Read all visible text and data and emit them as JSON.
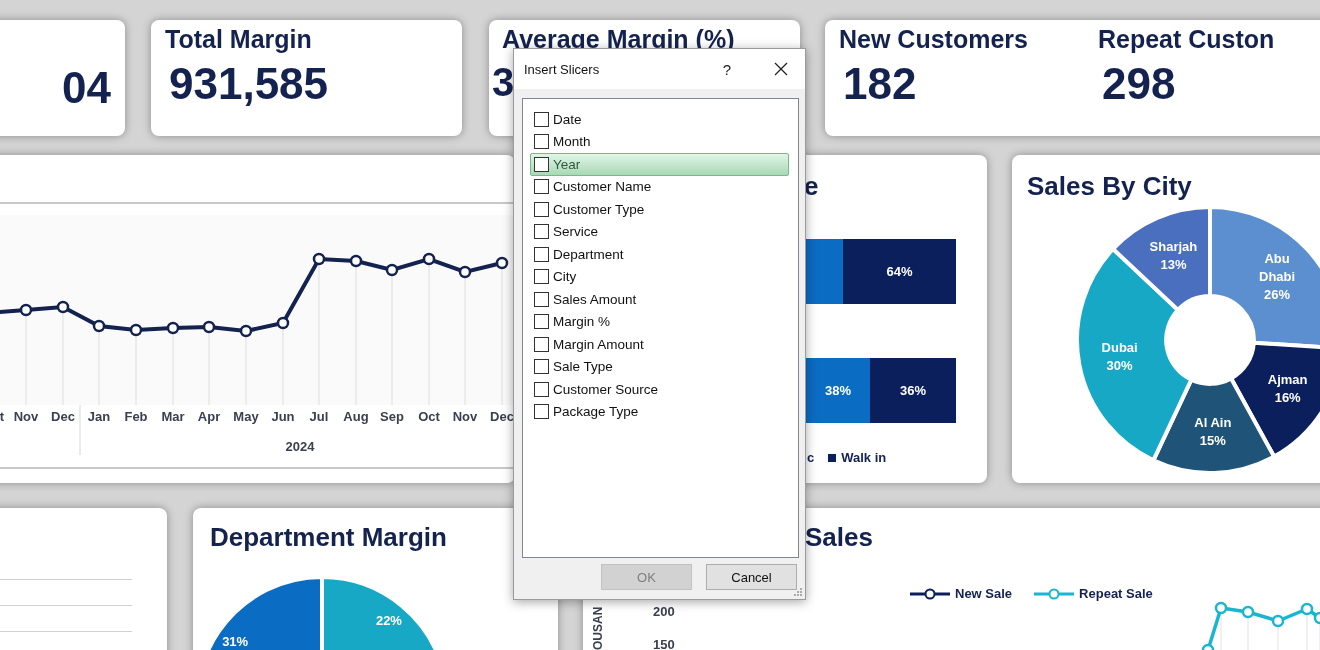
{
  "kpi_cards": [
    {
      "metrics": [
        {
          "value": "04"
        }
      ]
    },
    {
      "metrics": [
        {
          "title": "Total Margin",
          "value": "931,585"
        }
      ]
    },
    {
      "metrics": [
        {
          "title": "Average Margin (%)",
          "value": "3"
        }
      ]
    },
    {
      "metrics": [
        {
          "title": "New Customers",
          "value": "182"
        },
        {
          "title": "Repeat Custon",
          "value": "298"
        }
      ]
    }
  ],
  "trend_chart": {
    "x_labels": [
      "t",
      "Nov",
      "Dec",
      "Jan",
      "Feb",
      "Mar",
      "Apr",
      "May",
      "Jun",
      "Jul",
      "Aug",
      "Sep",
      "Oct",
      "Nov",
      "Dec"
    ],
    "year_label": "2024"
  },
  "type_chart": {
    "title": "e",
    "bars": [
      {
        "segments": [
          {
            "color": "#0b6cc4"
          },
          {
            "label": "64%",
            "color": "#0b1f5c"
          }
        ]
      },
      {
        "segments": [
          {
            "label": "38%",
            "color": "#0b6cc4"
          },
          {
            "label": "36%",
            "color": "#0b1f5c"
          }
        ]
      }
    ],
    "legend": [
      {
        "label": "c"
      },
      {
        "label": "Walk in",
        "color": "#0b1f5c"
      }
    ]
  },
  "city_chart": {
    "title": "Sales By City",
    "chart_data": {
      "type": "donut",
      "categories": [
        "Abu Dhabi",
        "Ajman",
        "Al Ain",
        "Dubai",
        "Sharjah"
      ],
      "values": [
        26,
        16,
        15,
        30,
        13
      ],
      "value_labels": [
        "26%",
        "16%",
        "15%",
        "30%",
        "13%"
      ],
      "data_labels": true
    }
  },
  "department_chart": {
    "title": "Department Margin",
    "chart_data": {
      "type": "pie",
      "values": [
        22,
        null,
        31
      ],
      "value_labels": [
        "22%",
        null,
        "31%"
      ],
      "data_labels": true
    }
  },
  "sales_chart": {
    "title": "Sales",
    "legend": [
      {
        "label": "New Sale",
        "color": "#0b1f5c"
      },
      {
        "label": "Repeat Sale",
        "color": "#1ab6cf"
      }
    ],
    "y_axis_title": "OUSAN",
    "y_ticks": [
      "200",
      "150"
    ]
  },
  "dialog": {
    "title": "Insert Slicers",
    "help": "?",
    "fields": [
      {
        "label": "Date",
        "checked": false,
        "selected": false
      },
      {
        "label": "Month",
        "checked": false,
        "selected": false
      },
      {
        "label": "Year",
        "checked": false,
        "selected": true
      },
      {
        "label": "Customer Name",
        "checked": false,
        "selected": false
      },
      {
        "label": "Customer Type",
        "checked": false,
        "selected": false
      },
      {
        "label": "Service",
        "checked": false,
        "selected": false
      },
      {
        "label": "Department",
        "checked": false,
        "selected": false
      },
      {
        "label": "City",
        "checked": false,
        "selected": false
      },
      {
        "label": "Sales Amount",
        "checked": false,
        "selected": false
      },
      {
        "label": "Margin %",
        "checked": false,
        "selected": false
      },
      {
        "label": "Margin Amount",
        "checked": false,
        "selected": false
      },
      {
        "label": "Sale Type",
        "checked": false,
        "selected": false
      },
      {
        "label": "Customer Source",
        "checked": false,
        "selected": false
      },
      {
        "label": "Package Type",
        "checked": false,
        "selected": false
      }
    ],
    "buttons": [
      {
        "label": "OK",
        "disabled": true
      },
      {
        "label": "Cancel",
        "disabled": false
      }
    ]
  }
}
